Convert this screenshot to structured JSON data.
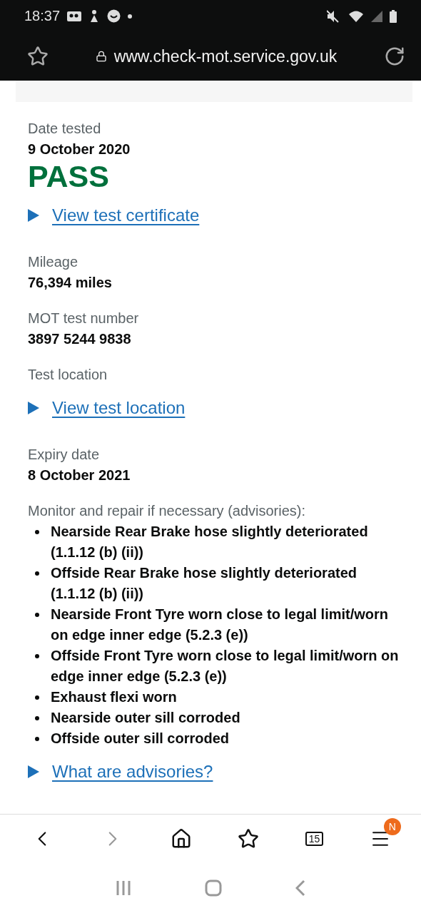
{
  "status_bar": {
    "time": "18:37"
  },
  "address_bar": {
    "url": "www.check-mot.service.gov.uk"
  },
  "items": [
    {
      "kind": "label",
      "text": "Date tested"
    },
    {
      "kind": "value",
      "text": "9 October 2020"
    },
    {
      "kind": "result",
      "text": "PASS"
    },
    {
      "kind": "link",
      "text": "View test certificate"
    },
    {
      "kind": "label",
      "text": "Mileage"
    },
    {
      "kind": "value",
      "text": "76,394 miles"
    },
    {
      "kind": "label",
      "text": "MOT test number"
    },
    {
      "kind": "value",
      "text": "3897 5244 9838"
    },
    {
      "kind": "label",
      "text": "Test location"
    },
    {
      "kind": "link",
      "text": "View test location"
    },
    {
      "kind": "label",
      "text": "Expiry date"
    },
    {
      "kind": "value",
      "text": "8 October 2021"
    },
    {
      "kind": "label",
      "text": "Monitor and repair if necessary (advisories):"
    },
    {
      "kind": "bullets",
      "entries": [
        "Nearside Rear Brake hose slightly deteriorated (1.1.12 (b) (ii))",
        "Offside Rear Brake hose slightly deteriorated (1.1.12 (b) (ii))",
        "Nearside Front Tyre worn close to legal limit/worn on edge inner edge (5.2.3 (e))",
        "Offside Front Tyre worn close to legal limit/worn on edge inner edge (5.2.3 (e))",
        "Exhaust flexi worn",
        "Nearside outer sill corroded",
        "Offside outer sill corroded"
      ]
    },
    {
      "kind": "link",
      "text": "What are advisories?"
    }
  ],
  "toolbar": {
    "back_disabled": false,
    "forward_disabled": true,
    "tab_count": "15",
    "menu_badge": "N"
  }
}
